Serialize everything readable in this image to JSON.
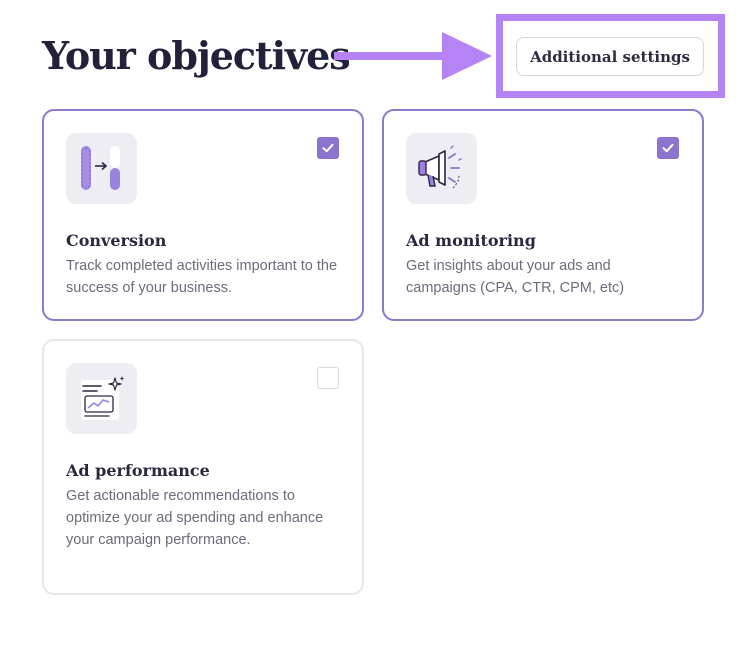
{
  "header": {
    "title": "Your objectives",
    "settings_button_label": "Additional settings"
  },
  "colors": {
    "accent": "#8c73cd",
    "annotation": "#b583f3",
    "border_unselected": "#e6e5ea"
  },
  "objectives": [
    {
      "title": "Conversion",
      "description": "Track completed activities important to the success of your business.",
      "checked": true,
      "icon": "conversion-icon"
    },
    {
      "title": "Ad monitoring",
      "description": "Get insights about your ads and campaigns (CPA, CTR, CPM, etc)",
      "checked": true,
      "icon": "megaphone-icon"
    },
    {
      "title": "Ad performance",
      "description": "Get actionable recommendations to optimize your ad spending and enhance your campaign performance.",
      "checked": false,
      "icon": "performance-chart-icon"
    }
  ]
}
